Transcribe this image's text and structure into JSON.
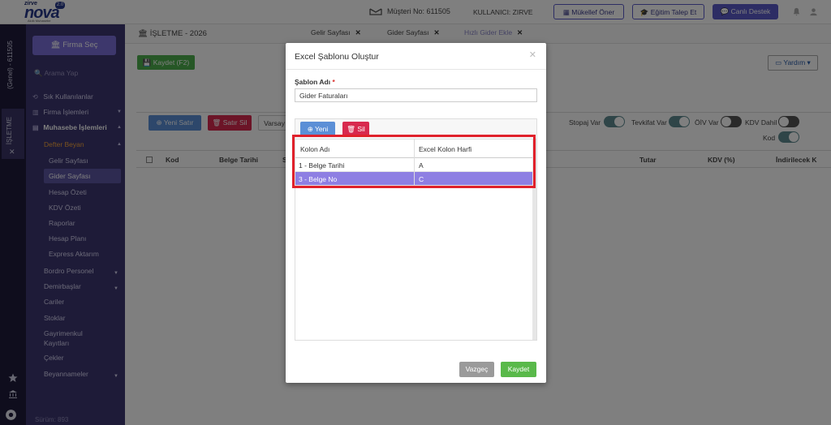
{
  "topbar": {
    "logo_brand": "zirve",
    "logo_name": "nova",
    "logo_version": "2.0",
    "logo_tagline": "Akıllı Muhasebe",
    "customer_no": "Müşteri No: 611505",
    "user": "KULLANICI: ZIRVE",
    "btn_mukellef": "Mükellef Öner",
    "btn_egitim": "Eğitim Talep Et",
    "btn_destek": "Canlı Destek"
  },
  "rail": {
    "genel": "(Genel) - 611505",
    "isletme": "İŞLETME"
  },
  "sidebar": {
    "firma_sec": "Firma Seç",
    "search_placeholder": "Arama Yap",
    "sik": "Sık Kullanılanlar",
    "firma_islemleri": "Firma İşlemleri",
    "muhasebe": "Muhasebe İşlemleri",
    "defter_beyan": "Defter Beyan",
    "subs": [
      "Gelir Sayfası",
      "Gider Sayfası",
      "Hesap Özeti",
      "KDV Özeti",
      "Raporlar",
      "Hesap Planı",
      "Express Aktarım"
    ],
    "bordro": "Bordro Personel",
    "demirbas": "Demirbaşlar",
    "cariler": "Cariler",
    "stoklar": "Stoklar",
    "gayrimenkul": "Gayrimenkul Kayıtları",
    "cekler": "Çekler",
    "beyannameler": "Beyannameler",
    "version": "Sürüm: 893"
  },
  "content": {
    "title": "İŞLETME - 2026",
    "tabs": [
      "Gelir Sayfası",
      "Gider Sayfası",
      "Hızlı Gider Ekle"
    ],
    "kaydet": "Kaydet (F2)",
    "yardim": "Yardım",
    "yeni_satir": "Yeni Satır",
    "satir_sil": "Satır Sil",
    "varsay": "Varsay",
    "toggles": [
      "Stopaj Var",
      "Tevkifat Var",
      "ÖİV Var",
      "KDV Dahil",
      "Kod"
    ],
    "columns": [
      "Kod",
      "Belge Tarihi",
      "S",
      "Tutar",
      "KDV (%)",
      "İndirilecek K"
    ]
  },
  "modal": {
    "title": "Excel Şablonu Oluştur",
    "label": "Şablon Adı",
    "required": "*",
    "value": "Gider Faturaları",
    "yeni": "Yeni",
    "sil": "Sil",
    "col_kolon": "Kolon Adı",
    "col_harf": "Excel Kolon Harfi",
    "rows": [
      {
        "kolon": "1 - Belge Tarihi",
        "harf": "A"
      },
      {
        "kolon": "3 - Belge No",
        "harf": "C"
      }
    ],
    "vazgec": "Vazgeç",
    "kaydet": "Kaydet"
  }
}
